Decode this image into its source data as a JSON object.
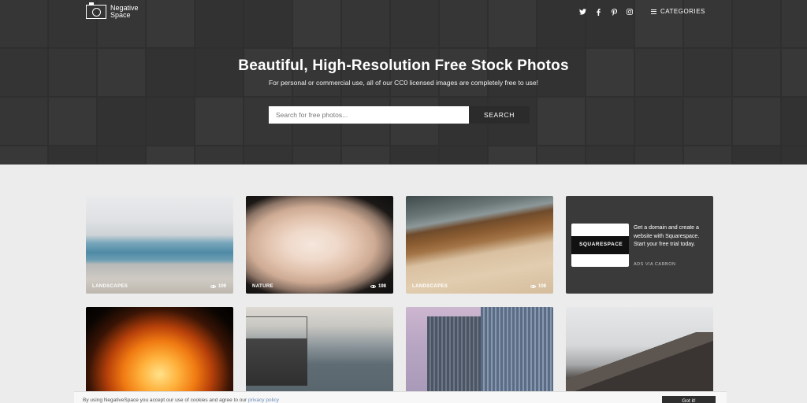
{
  "header": {
    "logo_text": "Negative Space",
    "socials": [
      {
        "name": "twitter-icon",
        "glyph": "🐦"
      },
      {
        "name": "facebook-icon",
        "glyph": "f"
      },
      {
        "name": "pinterest-icon",
        "glyph": "P"
      },
      {
        "name": "instagram-icon",
        "glyph": "◎"
      }
    ],
    "categories_label": "CATEGORIES"
  },
  "hero": {
    "title": "Beautiful, High-Resolution Free Stock Photos",
    "subtitle": "For personal or commercial use, all of our CC0 licensed images are completely free to use!",
    "search_placeholder": "Search for free photos...",
    "search_button": "SEARCH"
  },
  "cards": [
    {
      "category": "LANDSCAPES",
      "views": "109"
    },
    {
      "category": "NATURE",
      "views": "198"
    },
    {
      "category": "LANDSCAPES",
      "views": "108"
    }
  ],
  "ad": {
    "logo_text": "SQUARESPACE",
    "text": "Get a domain and create a website with Squarespace. Start your free trial today.",
    "via": "ADS VIA CARBON"
  },
  "cookie": {
    "text": "By using NegativeSpace you accept our use of cookies and agree to our",
    "link": "privacy policy",
    "button": "Got it!"
  },
  "colors": {
    "header_bg": "#3a3a3a",
    "page_bg": "#ececec",
    "button_dark": "#2b2b2b"
  }
}
